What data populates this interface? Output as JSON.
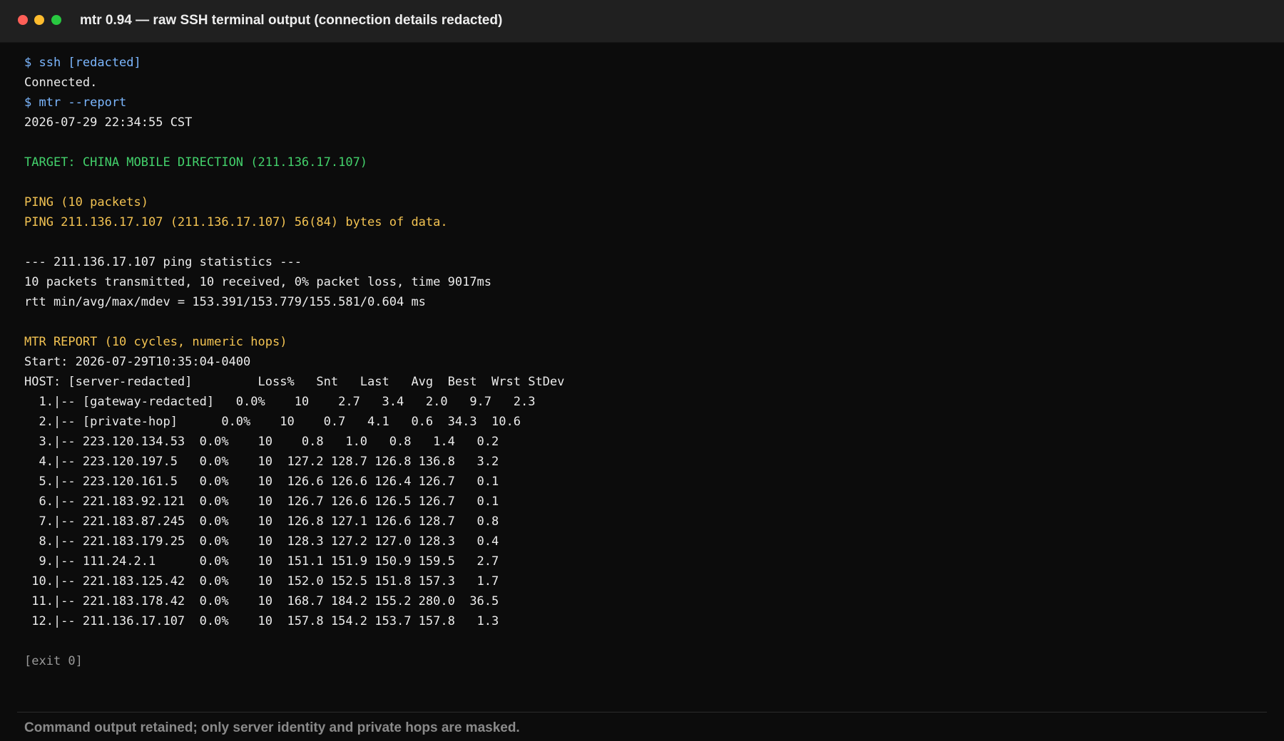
{
  "window": {
    "title": "mtr 0.94 — raw SSH terminal output (connection details redacted)"
  },
  "colors": {
    "command": "#7cb7ff",
    "target": "#43d16b",
    "section_header": "#f3c352",
    "plain": "#ececec",
    "exit": "#9a9a9a"
  },
  "terminal": {
    "lines": [
      "$ ssh [redacted]",
      "Connected.",
      "$ mtr --report",
      "2026-07-29 22:34:55 CST",
      "",
      "TARGET: CHINA MOBILE DIRECTION (211.136.17.107)",
      "",
      "PING (10 packets)",
      "PING 211.136.17.107 (211.136.17.107) 56(84) bytes of data.",
      "",
      "--- 211.136.17.107 ping statistics ---",
      "10 packets transmitted, 10 received, 0% packet loss, time 9017ms",
      "rtt min/avg/max/mdev = 153.391/153.779/155.581/0.604 ms",
      "",
      "MTR REPORT (10 cycles, numeric hops)",
      "Start: 2026-07-29T10:35:04-0400",
      "HOST: [server-redacted]         Loss%   Snt   Last   Avg  Best  Wrst StDev",
      "  1.|-- [gateway-redacted]   0.0%    10    2.7   3.4   2.0   9.7   2.3",
      "  2.|-- [private-hop]      0.0%    10    0.7   4.1   0.6  34.3  10.6",
      "  3.|-- 223.120.134.53  0.0%    10    0.8   1.0   0.8   1.4   0.2",
      "  4.|-- 223.120.197.5   0.0%    10  127.2 128.7 126.8 136.8   3.2",
      "  5.|-- 223.120.161.5   0.0%    10  126.6 126.6 126.4 126.7   0.1",
      "  6.|-- 221.183.92.121  0.0%    10  126.7 126.6 126.5 126.7   0.1",
      "  7.|-- 221.183.87.245  0.0%    10  126.8 127.1 126.6 128.7   0.8",
      "  8.|-- 221.183.179.25  0.0%    10  128.3 127.2 127.0 128.3   0.4",
      "  9.|-- 111.24.2.1      0.0%    10  151.1 151.9 150.9 159.5   2.7",
      " 10.|-- 221.183.125.42  0.0%    10  152.0 152.5 151.8 157.3   1.7",
      " 11.|-- 221.183.178.42  0.0%    10  168.7 184.2 155.2 280.0  36.5",
      " 12.|-- 211.136.17.107  0.0%    10  157.8 154.2 153.7 157.8   1.3",
      "",
      "[exit 0]"
    ]
  },
  "footer": {
    "note": "Command output retained; only server identity and private hops are masked."
  }
}
